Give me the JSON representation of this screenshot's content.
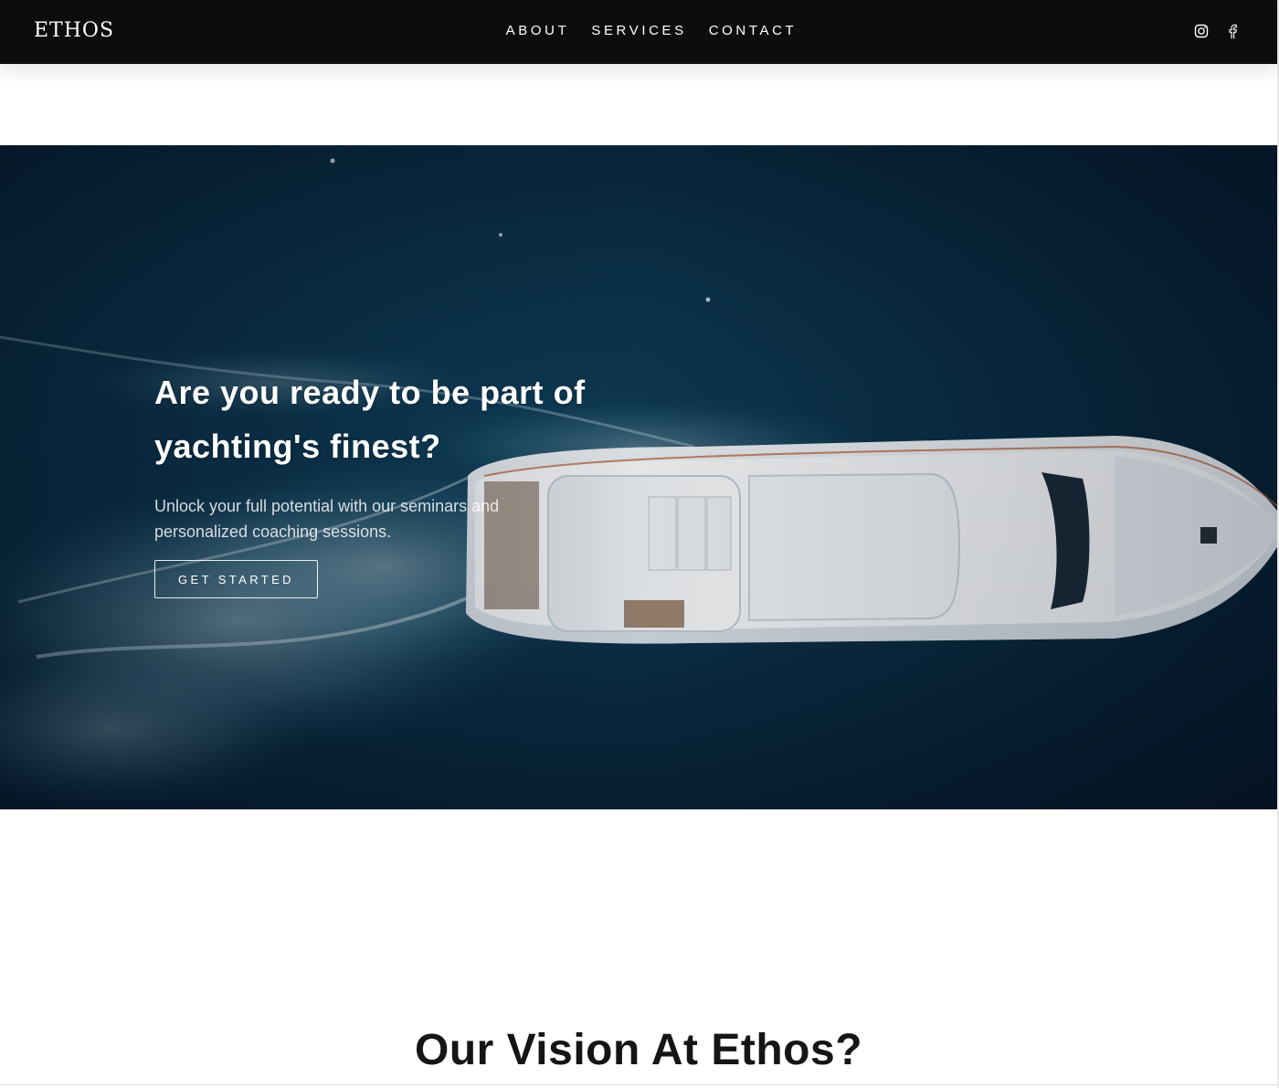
{
  "header": {
    "logo": "ETHOS",
    "nav": [
      {
        "label": "ABOUT"
      },
      {
        "label": "SERVICES"
      },
      {
        "label": "CONTACT"
      }
    ],
    "social": [
      {
        "icon": "instagram-icon"
      },
      {
        "icon": "facebook-icon"
      }
    ]
  },
  "hero": {
    "title": "Are you ready to be part of yachting's finest?",
    "subtitle": "Unlock your full potential with our seminars and personalized coaching sessions.",
    "cta_label": "GET STARTED",
    "image": "aerial-yacht-image"
  },
  "vision": {
    "title": "Our Vision At Ethos?"
  },
  "colors": {
    "header_bg": "#0d0d0d",
    "hero_sea": "#0b3048",
    "text_dark": "#151515",
    "white": "#ffffff"
  }
}
